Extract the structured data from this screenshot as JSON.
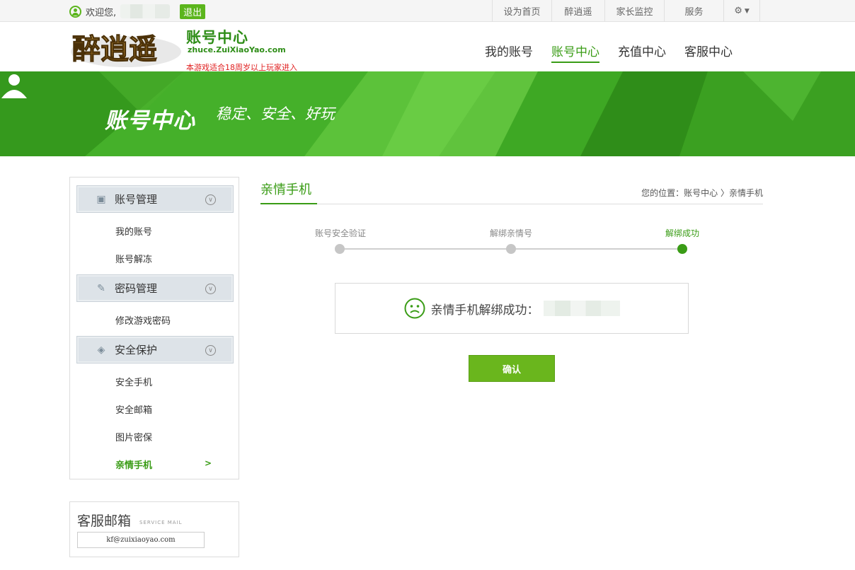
{
  "topbar": {
    "welcome": "欢迎您,",
    "logout_label": "退出",
    "links": [
      "设为首页",
      "醉逍遥",
      "家长监控",
      "服务"
    ],
    "icons": [
      "user-icon",
      "gear-icon"
    ]
  },
  "header": {
    "logo_text": "醉逍遥",
    "title": "账号中心",
    "domain": "zhuce.ZuiXiaoYao.com",
    "age_note": "本游戏适合18周岁以上玩家进入",
    "nav": [
      "我的账号",
      "账号中心",
      "充值中心",
      "客服中心"
    ],
    "active_nav": "账号中心"
  },
  "banner": {
    "title": "账号中心",
    "slogan": "稳定、安全、好玩"
  },
  "sidebar": {
    "groups": [
      {
        "label": "账号管理",
        "icon": "id-card-icon",
        "items": [
          "我的账号",
          "账号解冻"
        ]
      },
      {
        "label": "密码管理",
        "icon": "wrench-icon",
        "items": [
          "修改游戏密码"
        ]
      },
      {
        "label": "安全保护",
        "icon": "shield-icon",
        "items": [
          "安全手机",
          "安全邮箱",
          "图片密保",
          "亲情手机"
        ]
      }
    ],
    "active_item": "亲情手机",
    "active_arrow": ">"
  },
  "mailbox": {
    "title": "客服邮箱",
    "subtitle": "SERVICE MAIL",
    "address": "kf@zuixiaoyao.com"
  },
  "main": {
    "title": "亲情手机",
    "breadcrumb": "您的位置：账号中心 〉亲情手机",
    "steps": [
      "账号安全验证",
      "解绑亲情号",
      "解绑成功"
    ],
    "current_step": 3,
    "result_text": "亲情手机解绑成功：",
    "confirm_label": "确认"
  },
  "colors": {
    "accent": "#3a9c16",
    "button": "#6ab61d",
    "banner": "#3ea824"
  }
}
